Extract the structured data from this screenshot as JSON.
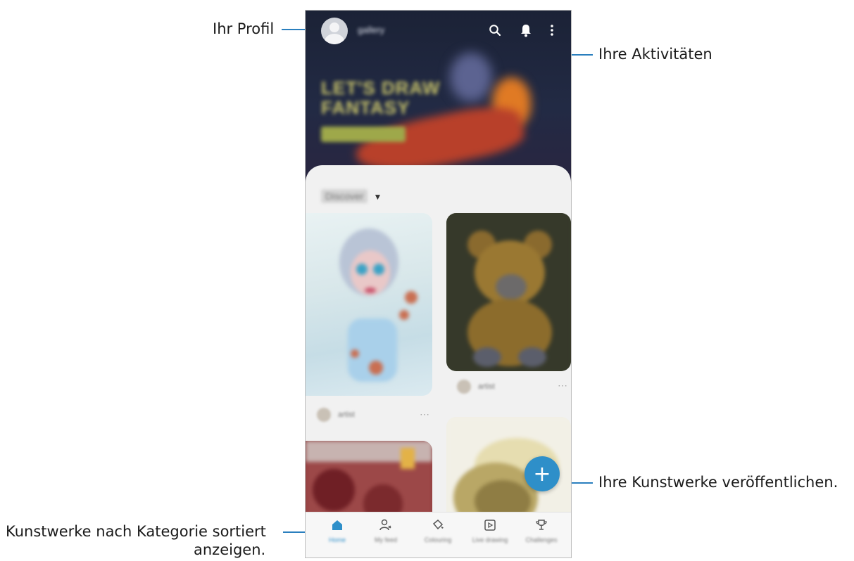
{
  "callouts": {
    "profile": "Ihr Profil",
    "activities": "Ihre Aktivitäten",
    "publish": "Ihre Kunstwerke veröffentlichen.",
    "category_line1": "Kunstwerke nach Kategorie sortiert",
    "category_line2": "anzeigen."
  },
  "header": {
    "username": "gallery",
    "icons": [
      "search-icon",
      "bell-icon",
      "more-vert-icon"
    ]
  },
  "hero": {
    "headline_line1": "LET'S DRAW",
    "headline_line2": "FANTASY"
  },
  "feed": {
    "filter_label": "Discover",
    "cards": [
      {
        "name": "artwork-princess",
        "author": "artist"
      },
      {
        "name": "artwork-teddy-bear",
        "author": "artist"
      },
      {
        "name": "artwork-red-flowers",
        "author": ""
      },
      {
        "name": "artwork-gold-object",
        "author": ""
      }
    ]
  },
  "fab": {
    "label": "+"
  },
  "nav": {
    "items": [
      {
        "label": "Home",
        "icon": "home-icon",
        "active": true
      },
      {
        "label": "My feed",
        "icon": "people-icon",
        "active": false
      },
      {
        "label": "Colouring",
        "icon": "paint-bucket-icon",
        "active": false
      },
      {
        "label": "Live drawing",
        "icon": "play-icon",
        "active": false
      },
      {
        "label": "Challenges",
        "icon": "trophy-icon",
        "active": false
      }
    ]
  },
  "colors": {
    "accent": "#2e8fc9",
    "callout_line": "#2a7fbe"
  }
}
